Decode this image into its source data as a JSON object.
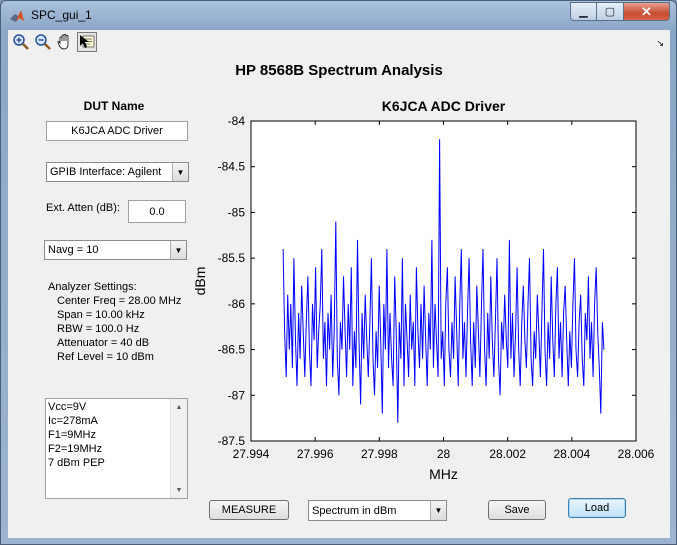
{
  "window": {
    "title": "SPC_gui_1"
  },
  "toolbar": {
    "tools": [
      "zoom-in-icon",
      "zoom-out-icon",
      "pan-hand-icon",
      "data-cursor-icon"
    ]
  },
  "heading": "HP 8568B Spectrum Analysis",
  "dut": {
    "label": "DUT Name",
    "value": "K6JCA ADC Driver"
  },
  "gpib": {
    "selected": "GPIB Interface: Agilent"
  },
  "atten": {
    "label": "Ext. Atten (dB):",
    "value": "0.0"
  },
  "navg": {
    "selected": "Navg = 10"
  },
  "settings": {
    "title": "Analyzer Settings:",
    "lines": [
      "Center Freq = 28.00 MHz",
      "Span = 10.00 kHz",
      "RBW = 100.0 Hz",
      "Attenuator = 40 dB",
      "Ref Level = 10 dBm"
    ]
  },
  "notes": {
    "lines": [
      "Vcc=9V",
      "Ic=278mA",
      "F1=9MHz",
      "F2=19MHz",
      "7 dBm PEP"
    ]
  },
  "buttons": {
    "measure": "MEASURE",
    "save": "Save",
    "load": "Load"
  },
  "plot_mode": {
    "selected": "Spectrum in dBm"
  },
  "colors": {
    "trace": "#0000ff",
    "close": "#c74c34"
  },
  "chart_data": {
    "type": "line",
    "title": "K6JCA ADC Driver",
    "xlabel": "MHz",
    "ylabel": "dBm",
    "xlim": [
      27.994,
      28.006
    ],
    "ylim": [
      -87.5,
      -84
    ],
    "xticks": [
      "27.994",
      "27.996",
      "27.998",
      "28",
      "28.002",
      "28.004",
      "28.006"
    ],
    "yticks": [
      "-84",
      "-84.5",
      "-85",
      "-85.5",
      "-86",
      "-86.5",
      "-87",
      "-87.5"
    ],
    "grid": false,
    "series": [
      {
        "x_start": 27.995,
        "x_end": 28.005,
        "values": [
          -85.4,
          -86.3,
          -86.8,
          -85.9,
          -86.5,
          -86.0,
          -86.7,
          -85.5,
          -86.4,
          -86.9,
          -86.1,
          -86.6,
          -85.8,
          -86.3,
          -86.8,
          -86.2,
          -85.7,
          -86.5,
          -86.9,
          -86.0,
          -86.4,
          -85.6,
          -86.7,
          -86.3,
          -86.0,
          -85.4,
          -86.6,
          -86.2,
          -86.9,
          -86.1,
          -86.5,
          -85.9,
          -86.8,
          -86.3,
          -85.1,
          -86.6,
          -87.0,
          -86.2,
          -86.5,
          -85.7,
          -86.3,
          -86.8,
          -86.0,
          -86.5,
          -85.6,
          -86.9,
          -86.3,
          -86.7,
          -85.3,
          -86.4,
          -87.1,
          -86.1,
          -86.6,
          -85.9,
          -86.4,
          -86.8,
          -86.2,
          -85.5,
          -86.6,
          -87.0,
          -86.3,
          -86.7,
          -85.8,
          -86.4,
          -87.2,
          -86.0,
          -86.5,
          -85.4,
          -86.7,
          -86.1,
          -86.6,
          -86.9,
          -85.7,
          -86.3,
          -87.3,
          -86.2,
          -86.6,
          -85.5,
          -86.9,
          -86.0,
          -86.4,
          -86.8,
          -85.9,
          -86.5,
          -86.2,
          -86.9,
          -85.6,
          -86.3,
          -86.7,
          -86.0,
          -86.6,
          -85.8,
          -86.4,
          -86.9,
          -86.1,
          -86.5,
          -85.3,
          -86.7,
          -86.0,
          -86.4,
          -86.8,
          -84.2,
          -86.6,
          -86.3,
          -86.9,
          -86.0,
          -85.6,
          -86.5,
          -86.8,
          -86.2,
          -86.6,
          -85.7,
          -86.3,
          -86.9,
          -86.0,
          -85.4,
          -86.6,
          -86.2,
          -86.8,
          -86.1,
          -85.5,
          -86.4,
          -86.9,
          -86.2,
          -86.7,
          -85.8,
          -86.3,
          -86.8,
          -86.0,
          -85.4,
          -86.5,
          -86.9,
          -86.1,
          -86.6,
          -85.7,
          -86.4,
          -86.8,
          -86.2,
          -85.5,
          -86.6,
          -87.0,
          -86.2,
          -86.5,
          -85.9,
          -86.4,
          -86.7,
          -85.3,
          -86.6,
          -86.1,
          -86.8,
          -86.3,
          -85.6,
          -86.5,
          -86.9,
          -86.2,
          -85.8,
          -86.4,
          -86.7,
          -86.0,
          -85.5,
          -86.6,
          -86.9,
          -86.3,
          -86.6,
          -85.9,
          -86.3,
          -86.8,
          -86.1,
          -85.4,
          -86.5,
          -86.9,
          -86.2,
          -86.6,
          -85.7,
          -86.4,
          -86.8,
          -86.0,
          -85.6,
          -86.6,
          -86.2,
          -86.8,
          -86.1,
          -85.8,
          -86.4,
          -86.9,
          -86.3,
          -86.7,
          -86.0,
          -85.5,
          -86.5,
          -86.8,
          -86.2,
          -85.9,
          -86.6,
          -86.9,
          -86.1,
          -86.4,
          -85.7,
          -86.6,
          -86.2,
          -86.8,
          -86.0,
          -85.6,
          -86.3,
          -86.7,
          -87.2,
          -86.2,
          -86.5
        ]
      }
    ]
  }
}
